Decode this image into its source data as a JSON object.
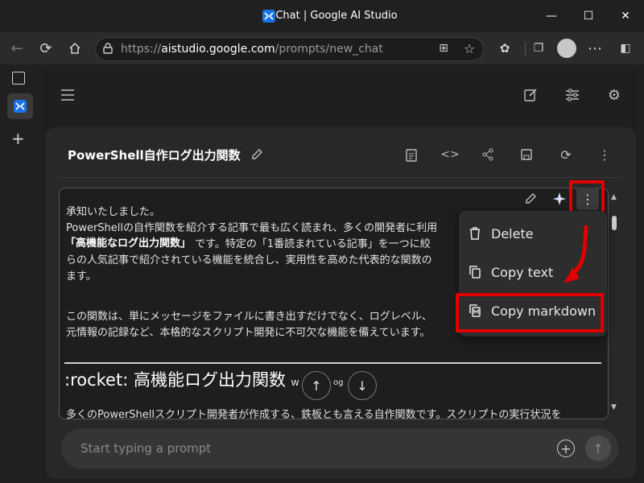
{
  "window": {
    "title": "Chat | Google AI Studio"
  },
  "browser": {
    "url_prefix": "https://",
    "url_domain": "aistudio.google.com",
    "url_path": "/prompts/new_chat"
  },
  "prompt": {
    "title": "PowerShell自作ログ出力関数"
  },
  "response": {
    "lines": [
      "承知いたしました。",
      "PowerShellの自作関数を紹介する記事で最も広く読まれ、多くの開発者に利用",
      "「高機能なログ出力関数」 です。特定の「1番読まれている記事」を一つに絞",
      "らの人気記事で紹介されている機能を統合し、実用性を高めた代表的な関数の",
      "ます。",
      "この関数は、単にメッセージをファイルに書き出すだけでなく、ログレベル、",
      "元情報の記録など、本格的なスクリプト開発に不可欠な機能を備えています。",
      "多くのPowerShellスクリプト開発者が作成する、鉄板とも言える自作関数です。スクリプトの実行状況を"
    ],
    "bold_part": "「高機能なログ出力関数」",
    "heading": ":rocket: 高機能ログ出力関数",
    "heading_suffix": "W",
    "heading_suffix2": "og"
  },
  "menu": {
    "items": [
      {
        "label": "Delete",
        "icon": "trash-icon"
      },
      {
        "label": "Copy text",
        "icon": "copy-icon"
      },
      {
        "label": "Copy markdown",
        "icon": "markdown-copy-icon"
      }
    ]
  },
  "input": {
    "placeholder": "Start typing a prompt"
  },
  "colors": {
    "highlight": "#e00000",
    "accent": "#3b82f6"
  }
}
